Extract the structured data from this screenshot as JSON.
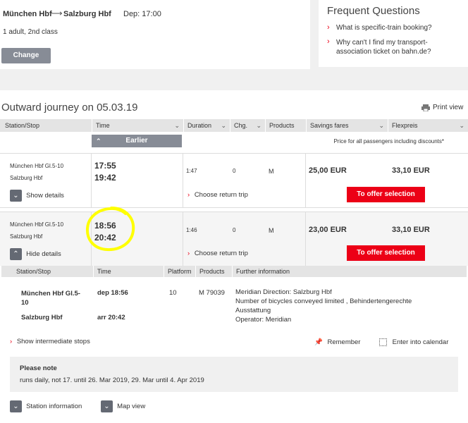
{
  "search": {
    "origin": "München Hbf",
    "destination": "Salzburg Hbf",
    "departure": "Dep: 17:00",
    "passengers": "1 adult, 2nd class",
    "change_label": "Change"
  },
  "faq": {
    "title": "Frequent Questions",
    "items": [
      "What is specific-train booking?",
      "Why can't I find my transport-\nassociation ticket on bahn.de?"
    ]
  },
  "journey": {
    "title": "Outward journey on 05.03.19",
    "print_label": "Print view",
    "columns": [
      "Station/Stop",
      "Time",
      "Duration",
      "Chg.",
      "Products",
      "Savings fares",
      "Flexpreis"
    ],
    "earlier_label": "Earlier",
    "price_note": "Price for all passengers including discounts*",
    "connections": [
      {
        "from": "München Hbf Gl.5-10",
        "to": "Salzburg Hbf",
        "dep": "17:55",
        "arr": "19:42",
        "duration": "1:47",
        "changes": "0",
        "product": "M",
        "savings": "25,00 EUR",
        "flex": "33,10 EUR",
        "toggle_label": "Show details",
        "return_label": "Choose return trip",
        "offer_label": "To offer selection"
      },
      {
        "from": "München Hbf Gl.5-10",
        "to": "Salzburg Hbf",
        "dep": "18:56",
        "arr": "20:42",
        "duration": "1:46",
        "changes": "0",
        "product": "M",
        "savings": "23,00 EUR",
        "flex": "33,10 EUR",
        "toggle_label": "Hide details",
        "return_label": "Choose return trip",
        "offer_label": "To offer selection"
      }
    ],
    "details": {
      "columns": [
        "Station/Stop",
        "Time",
        "Platform",
        "Products",
        "Further information"
      ],
      "from_station": "München Hbf Gl.5-\n10",
      "to_station": "Salzburg Hbf",
      "dep": "dep 18:56",
      "arr": "arr 20:42",
      "platform": "10",
      "product": "M 79039",
      "info_lines": [
        "Meridian Direction: Salzburg Hbf",
        "Number of bicycles conveyed limited , Behindertengerechte",
        "Ausstattung",
        "Operator: Meridian"
      ],
      "intermediate_label": "Show intermediate stops",
      "remember_label": "Remember",
      "calendar_label": "Enter into calendar",
      "note_title": "Please note",
      "note_text": "runs daily, not 17. until 26. Mar 2019, 29. Mar until 4. Apr 2019",
      "station_info_label": "Station information",
      "map_label": "Map view"
    }
  },
  "colors": {
    "accent": "#ec0016",
    "highlight": "#ffff00"
  }
}
